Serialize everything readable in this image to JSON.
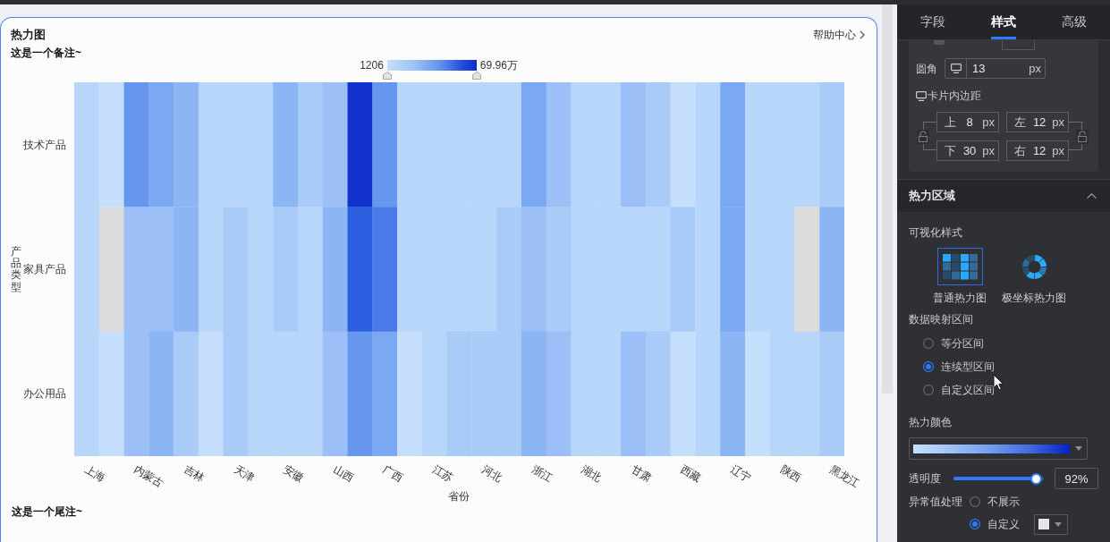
{
  "chart_card": {
    "selected": true,
    "title": "热力图",
    "help_link": "帮助中心",
    "note": "这是一个备注~",
    "legend": {
      "min_label": "1206",
      "max_label": "69.96万"
    },
    "y_axis": {
      "name": "产品类型",
      "labels": [
        "技术产品",
        "家具产品",
        "办公用品"
      ]
    },
    "x_axis": {
      "name": "省份",
      "labels": [
        "上海",
        "内蒙古",
        "吉林",
        "天津",
        "安徽",
        "山西",
        "广西",
        "江苏",
        "河北",
        "浙江",
        "湖北",
        "甘肃",
        "西藏",
        "辽宁",
        "陕西",
        "黑龙江"
      ]
    },
    "footnote": "这是一个尾注~"
  },
  "settings_panel": {
    "tabs": [
      {
        "label": "字段",
        "selected": false
      },
      {
        "label": "样式",
        "selected": true
      },
      {
        "label": "高级",
        "selected": false
      }
    ],
    "card_style": {
      "clipped_option": {
        "checked": false
      },
      "corner_radius": {
        "label": "圆角",
        "value": "13",
        "unit": "px"
      },
      "padding": {
        "label": "卡片内边距",
        "fields": [
          {
            "label": "上",
            "value": "8",
            "unit": "px"
          },
          {
            "label": "左",
            "value": "12",
            "unit": "px"
          },
          {
            "label": "下",
            "value": "30",
            "unit": "px"
          },
          {
            "label": "右",
            "value": "12",
            "unit": "px"
          }
        ]
      }
    },
    "heat_section": {
      "title": "热力区域",
      "expanded": true,
      "visual_style": {
        "label": "可视化样式",
        "options": [
          {
            "kind": "grid",
            "label": "普通热力图",
            "selected": true
          },
          {
            "kind": "polar",
            "label": "极坐标热力图",
            "selected": false
          }
        ]
      },
      "mapping": {
        "label": "数据映射区间",
        "options": [
          {
            "label": "等分区间",
            "selected": false
          },
          {
            "label": "连续型区间",
            "selected": true
          },
          {
            "label": "自定义区间",
            "selected": false
          }
        ]
      },
      "heat_color": {
        "label": "热力颜色"
      },
      "opacity": {
        "label": "透明度",
        "level": 0.92,
        "value": "92%"
      },
      "outliers": {
        "label": "异常值处理",
        "options": [
          {
            "kind": "plain",
            "label": "不展示",
            "selected": false
          },
          {
            "kind": "color",
            "label": "自定义",
            "selected": true
          }
        ]
      }
    }
  }
}
